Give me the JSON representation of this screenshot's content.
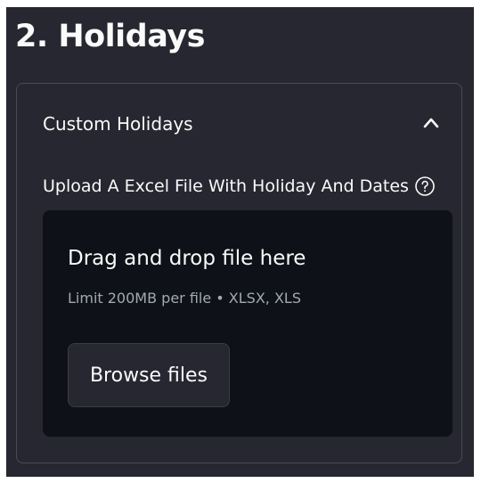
{
  "section": {
    "title": "2. Holidays"
  },
  "expander": {
    "label": "Custom Holidays",
    "state": "expanded",
    "icon": "chevron-up-icon"
  },
  "uploader": {
    "label": "Upload A Excel File With Holiday And Dates",
    "help_icon": "question-circle-icon",
    "dropzone": {
      "title": "Drag and drop file here",
      "limit_text": "Limit 200MB per file • XLSX, XLS"
    },
    "browse_button_label": "Browse files"
  },
  "colors": {
    "panel_bg": "#262730",
    "dropzone_bg": "#0e1117",
    "text_primary": "#fafafa",
    "text_secondary": "#a3a8b4",
    "border": "#4a4b55"
  }
}
